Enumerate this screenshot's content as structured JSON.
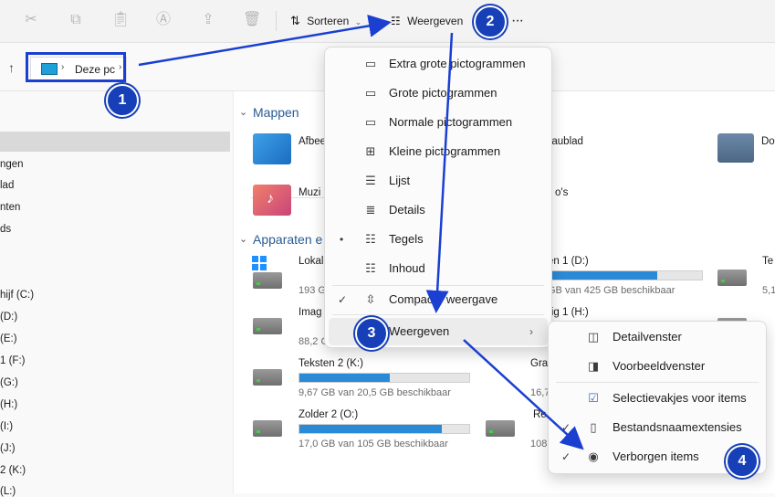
{
  "toolbar": {
    "sort_label": "Sorteren",
    "view_label": "Weergeven",
    "more_label": "···"
  },
  "address": {
    "location": "Deze pc"
  },
  "nav": {
    "items": [
      "ngen",
      "lad",
      "nten",
      "ds",
      "hijf (C:)",
      "(D:)",
      "(E:)",
      "1 (F:)",
      "(G:)",
      "(H:)",
      "(I:)",
      "(J:)",
      "2 (K:)",
      "(L:)"
    ]
  },
  "content": {
    "folders_header": "Mappen",
    "devices_header": "Apparaten e",
    "folders": [
      {
        "name": "Afbee"
      },
      {
        "name": "eaublad"
      },
      {
        "name": "Do"
      },
      {
        "name": "Muzi"
      },
      {
        "name": "o's"
      }
    ],
    "drives": [
      {
        "name": "Lokal",
        "sub": "193 G",
        "fill": 0.0
      },
      {
        "name": "en 1 (D:)",
        "sub": "GB van 425 GB beschikbaar",
        "fill": 0.95
      },
      {
        "name": "Te",
        "sub": "5,1",
        "fill": 0.0
      },
      {
        "name": "Imag",
        "sub": "88,2 G",
        "fill": 0.0
      },
      {
        "name": "rig 1 (H:)",
        "sub": "",
        "fill": 0.0
      },
      {
        "name": "Teksten 2 (K:)",
        "sub": "9,67 GB van 20,5 GB beschikbaar",
        "fill": 0.53
      },
      {
        "name": "Gra",
        "sub": "16,7",
        "fill": 0.0
      },
      {
        "name": "Zolder 2 (O:)",
        "sub": "17,0 GB van 105 GB beschikbaar",
        "fill": 0.84
      },
      {
        "name": "Re",
        "sub": "108",
        "fill": 0.0
      }
    ]
  },
  "view_menu": {
    "items": [
      {
        "label": "Extra grote pictogrammen",
        "icon": "monitor-icon"
      },
      {
        "label": "Grote pictogrammen",
        "icon": "monitor-icon"
      },
      {
        "label": "Normale pictogrammen",
        "icon": "monitor-icon"
      },
      {
        "label": "Kleine pictogrammen",
        "icon": "grid-icon"
      },
      {
        "label": "Lijst",
        "icon": "list-icon"
      },
      {
        "label": "Details",
        "icon": "details-icon"
      },
      {
        "label": "Tegels",
        "icon": "tiles-icon",
        "selected": true
      },
      {
        "label": "Inhoud",
        "icon": "content-icon"
      },
      {
        "label": "Compacte weergave",
        "icon": "compact-icon",
        "checked": true
      },
      {
        "label": "Weergeven",
        "icon": "",
        "submenu": true
      }
    ]
  },
  "show_menu": {
    "items": [
      {
        "label": "Detailvenster",
        "icon": "details-pane-icon"
      },
      {
        "label": "Voorbeeldvenster",
        "icon": "preview-pane-icon"
      },
      {
        "label": "Selectievakjes voor items",
        "icon": "checkbox-icon"
      },
      {
        "label": "Bestandsnaamextensies",
        "icon": "file-icon",
        "checked": true
      },
      {
        "label": "Verborgen items",
        "icon": "eye-icon",
        "checked": true
      }
    ]
  },
  "badges": [
    "1",
    "2",
    "3",
    "4"
  ],
  "colors": {
    "accent": "#2b8ad6",
    "badge": "#1740b8",
    "arrow": "#1a3fd1",
    "section": "#2a5b93"
  }
}
